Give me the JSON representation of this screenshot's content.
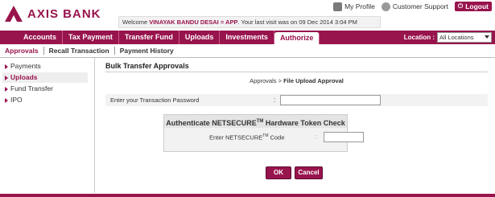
{
  "header": {
    "brand": "AXIS BANK",
    "welcome_prefix": "Welcome ",
    "welcome_user": "VINAYAK BANDU DESAI = APP",
    "welcome_suffix": ". Your last visit was on 09 Dec 2014 3:04 PM",
    "links": {
      "profile": "My Profile",
      "support": "Customer Support",
      "logout": "Logout"
    }
  },
  "main_nav": {
    "items": [
      "Accounts",
      "Tax Payment",
      "Transfer Fund",
      "Uploads",
      "Investments",
      "Authorize"
    ],
    "location_label": "Location :",
    "location_value": "All Locations"
  },
  "sub_nav": {
    "items": [
      "Approvals",
      "Recall Transaction",
      "Payment History"
    ]
  },
  "left_menu": {
    "items": [
      "Payments",
      "Uploads",
      "Fund Transfer",
      "IPO"
    ]
  },
  "content": {
    "title": "Bulk Transfer Approvals",
    "breadcrumb_root": "Approvals",
    "breadcrumb_sep": " > ",
    "breadcrumb_current": "File Upload Approval",
    "password_label": "Enter your Transaction Password",
    "colon": ":",
    "token_title": "Authenticate NETSECURE",
    "token_tm": "TM",
    "token_title_rest": " Hardware Token Check",
    "token_label": "Enter NETSECURE",
    "token_label_tm": "TM",
    "token_label_rest": " Code",
    "ok": "OK",
    "cancel": "Cancel"
  },
  "colors": {
    "brand": "#98144d",
    "panel": "#f2f2f2"
  }
}
